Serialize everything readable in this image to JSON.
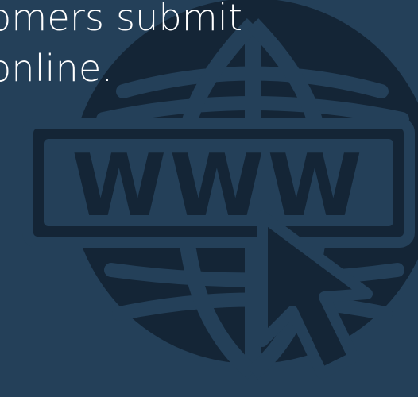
{
  "slide": {
    "background_color": "#244059",
    "caption_color": "#ffffff",
    "caption_lines": [
      "omers submit",
      "online."
    ]
  },
  "illustration": {
    "globe_color": "#142536",
    "box_text": "WWW",
    "icons": [
      "globe-icon",
      "www-box-icon",
      "mouse-cursor-icon"
    ]
  }
}
